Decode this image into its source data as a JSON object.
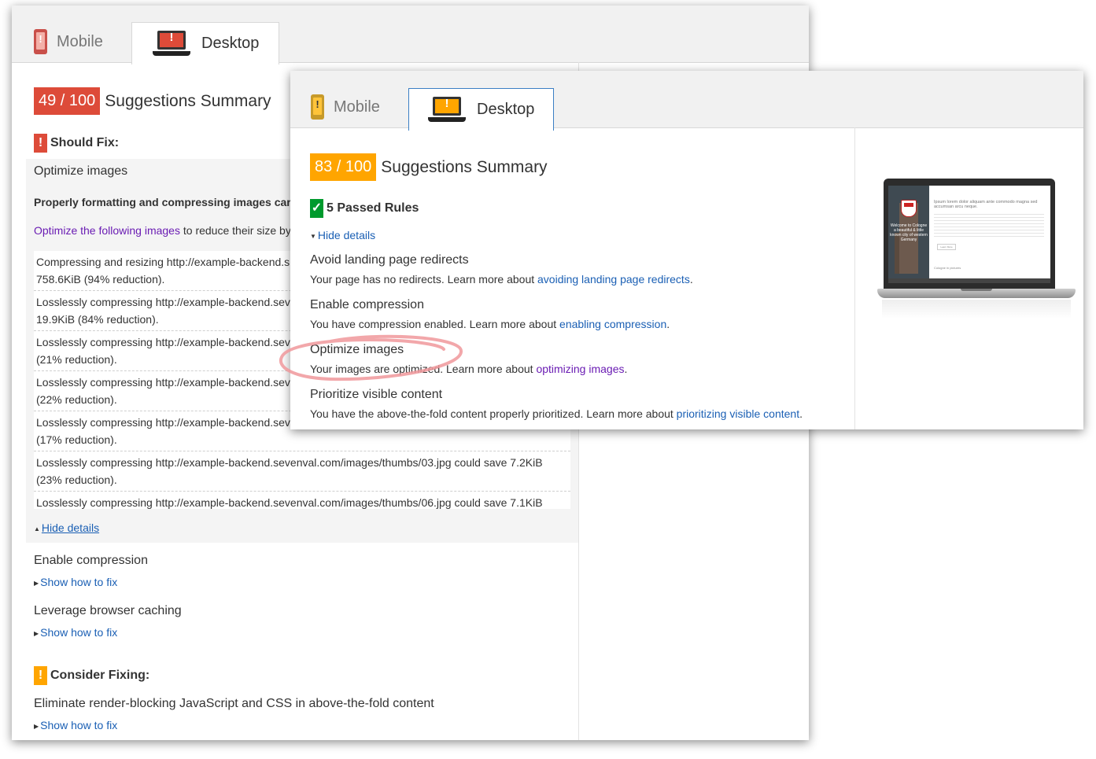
{
  "colors": {
    "red": "#dd4b39",
    "orange": "#ffa500",
    "green": "#009a2d",
    "link": "#1a5fb4",
    "visited_link": "#6a1cb3",
    "annotation": "#f0989b"
  },
  "back": {
    "tabs": {
      "mobile_label": "Mobile",
      "desktop_label": "Desktop",
      "mobile_icon": "phone-warning-icon",
      "desktop_icon": "laptop-warning-icon"
    },
    "score": "49 / 100",
    "summary_title": "Suggestions Summary",
    "should_fix": {
      "badge": "!",
      "heading": "Should Fix:",
      "rule_title": "Optimize images",
      "bold_intro": "Properly formatting and compressing images car",
      "intro_link": "Optimize the following images",
      "intro_rest": "to reduce their size by",
      "rows": [
        {
          "line1": "Compressing and resizing http://example-backend.s",
          "line2": "758.6KiB (94% reduction)."
        },
        {
          "line1": "Losslessly compressing http://example-backend.sev",
          "line2": "19.9KiB (84% reduction)."
        },
        {
          "line1": "Losslessly compressing http://example-backend.sev",
          "line2": "(21% reduction)."
        },
        {
          "line1": "Losslessly compressing http://example-backend.sev",
          "line2": "(22% reduction)."
        },
        {
          "line1": "Losslessly compressing http://example-backend.sev",
          "line2": "(17% reduction)."
        },
        {
          "line1": "Losslessly compressing http://example-backend.sevenval.com/images/thumbs/03.jpg could save 7.2KiB",
          "line2": "(23% reduction)."
        },
        {
          "line1": "Losslessly compressing http://example-backend.sevenval.com/images/thumbs/06.jpg could save 7.1KiB",
          "line2": ""
        }
      ],
      "hide_details": "Hide details",
      "enable_compression": "Enable compression",
      "show_fix_1": "Show how to fix",
      "leverage_caching": "Leverage browser caching",
      "show_fix_2": "Show how to fix"
    },
    "consider_fixing": {
      "badge": "!",
      "heading": "Consider Fixing:",
      "rule_title": "Eliminate render-blocking JavaScript and CSS in above-the-fold content",
      "show_fix": "Show how to fix"
    }
  },
  "front": {
    "tabs": {
      "mobile_label": "Mobile",
      "desktop_label": "Desktop",
      "mobile_icon": "phone-warning-icon",
      "desktop_icon": "laptop-warning-icon"
    },
    "score": "83 / 100",
    "summary_title": "Suggestions Summary",
    "passed": {
      "badge": "✓",
      "heading": "5 Passed Rules",
      "hide_details": "Hide details"
    },
    "rules": [
      {
        "title": "Avoid landing page redirects",
        "desc": "Your page has no redirects. Learn more about ",
        "link": "avoiding landing page redirects",
        "end": "."
      },
      {
        "title": "Enable compression",
        "desc": "You have compression enabled. Learn more about ",
        "link": "enabling compression",
        "end": "."
      },
      {
        "title": "Optimize images",
        "desc": "Your images are optimized. Learn more about ",
        "link": "optimizing images",
        "end": "."
      },
      {
        "title": "Prioritize visible content",
        "desc": "You have the above-the-fold content properly prioritized. Learn more about ",
        "link": "prioritizing visible content",
        "end": "."
      }
    ],
    "preview": {
      "headline": "Ipsum lorem dolor aliquam ante commodo magna sed accumsan arcu neque.",
      "left_caption": "Welcome to Cologne a beautiful & little known city of western Germany",
      "button": "Learn More",
      "footer": "Cologne in pictures",
      "icon": "laptop-preview-icon"
    }
  }
}
